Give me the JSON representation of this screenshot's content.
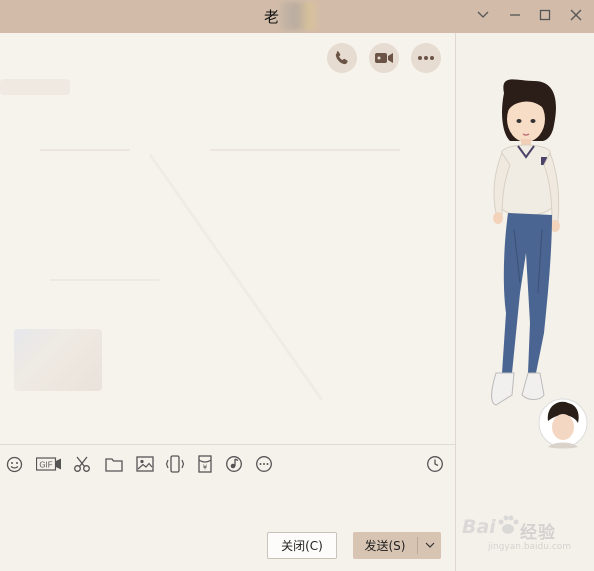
{
  "window": {
    "title": "老",
    "minimize_icon": "minimize-icon",
    "maximize_icon": "maximize-icon",
    "close_icon": "close-icon",
    "dropdown_icon": "chevron-down-icon"
  },
  "header_actions": [
    {
      "name": "voice-call-button",
      "icon": "phone-icon"
    },
    {
      "name": "video-call-button",
      "icon": "video-camera-icon"
    },
    {
      "name": "more-button",
      "icon": "more-dots-icon"
    }
  ],
  "toolbar": {
    "gif_label": "GIF",
    "tools": [
      "emoji-icon",
      "gif-icon",
      "screenshot-scissors-icon",
      "folder-icon",
      "image-icon",
      "shake-icon",
      "red-packet-icon",
      "music-icon",
      "more-icon",
      "history-clock-icon"
    ]
  },
  "actions": {
    "close_label": "关闭(C)",
    "send_label": "发送(S)"
  },
  "watermark": {
    "brand": "Bai",
    "brand_cn": "经验",
    "url": "jingyan.baidu.com"
  },
  "colors": {
    "titlebar": "#d2bca9",
    "chat_bg": "#f6f2ec",
    "send_button": "#d8c4b2",
    "icon": "#6b5446"
  }
}
